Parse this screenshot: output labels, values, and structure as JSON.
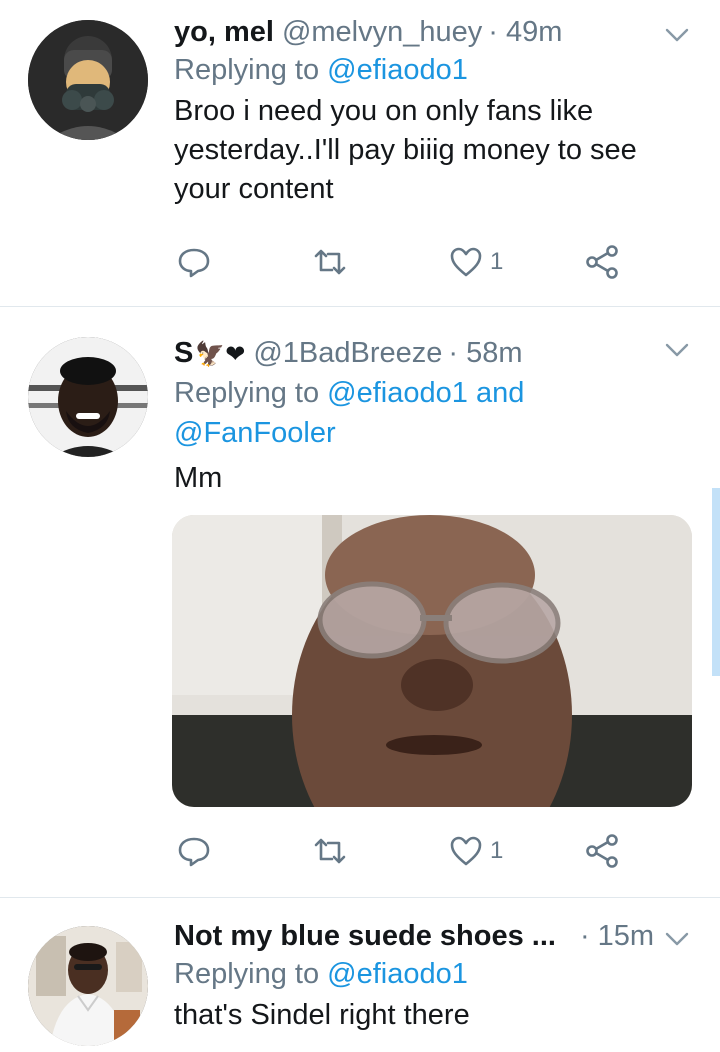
{
  "tweets": [
    {
      "name": "yo, mel",
      "handle": "@melvyn_huey",
      "time": "· 49m",
      "replying_prefix": "Replying to",
      "replying_to": "@efiaodo1",
      "replying_and": "",
      "replying_to2": "",
      "text": "Broo i need you on only fans like yesterday..I'll pay biiig money to see your content",
      "likes": "1"
    },
    {
      "name": "S",
      "name_emoji": "🦅❤",
      "handle": "@1BadBreeze",
      "time": "· 58m",
      "replying_prefix": "Replying to",
      "replying_to": "@efiaodo1",
      "replying_and": "and",
      "replying_to2": "@FanFooler",
      "text": "Mm",
      "likes": "1"
    },
    {
      "name": "Not my blue suede shoes ...",
      "handle": "",
      "time": "· 15m",
      "replying_prefix": "Replying to",
      "replying_to": "@efiaodo1",
      "text": "that's Sindel right there"
    }
  ],
  "colors": {
    "accent": "#1b95e0",
    "secondary_text": "#657786",
    "divider": "#e1e8ed"
  },
  "icons": [
    "reply-icon",
    "retweet-icon",
    "like-icon",
    "share-icon",
    "chevron-down-icon"
  ]
}
